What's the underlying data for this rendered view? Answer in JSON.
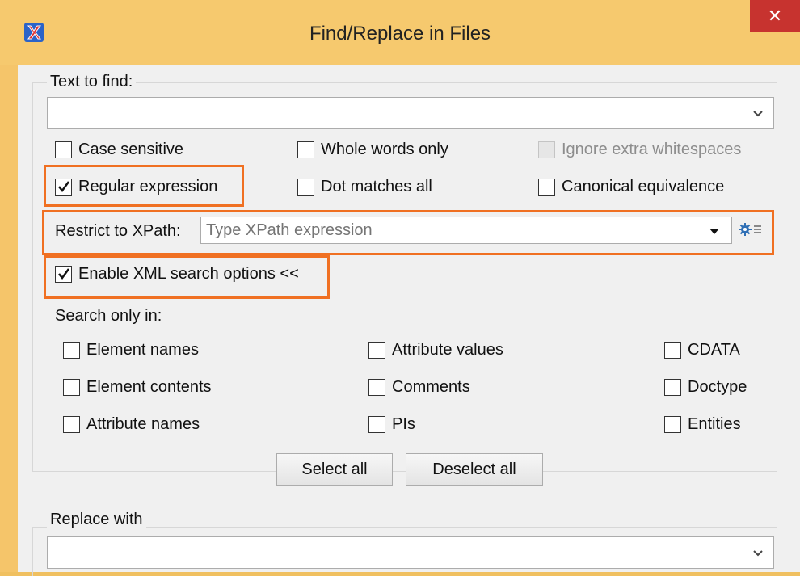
{
  "window": {
    "title": "Find/Replace in Files",
    "close_glyph": "✕",
    "app_icon": "oxygen-x-icon"
  },
  "find": {
    "legend": "Text to find:",
    "value": ""
  },
  "options": {
    "case_sensitive": {
      "label": "Case sensitive",
      "checked": false
    },
    "whole_words": {
      "label": "Whole words only",
      "checked": false
    },
    "ignore_whitespace": {
      "label": "Ignore extra whitespaces",
      "checked": false,
      "disabled": true
    },
    "regex": {
      "label": "Regular expression",
      "checked": true
    },
    "dot_all": {
      "label": "Dot matches all",
      "checked": false
    },
    "canonical": {
      "label": "Canonical equivalence",
      "checked": false
    }
  },
  "xpath": {
    "label": "Restrict to XPath:",
    "placeholder": "Type XPath expression",
    "settings_icon": "gear-menu-icon"
  },
  "xml_options": {
    "label": "Enable XML search options <<",
    "checked": true
  },
  "search_only": {
    "label": "Search only in:",
    "items": [
      {
        "label": "Element names",
        "checked": false
      },
      {
        "label": "Attribute values",
        "checked": false
      },
      {
        "label": "CDATA",
        "checked": false
      },
      {
        "label": "Element contents",
        "checked": false
      },
      {
        "label": "Comments",
        "checked": false
      },
      {
        "label": "Doctype",
        "checked": false
      },
      {
        "label": "Attribute names",
        "checked": false
      },
      {
        "label": "PIs",
        "checked": false
      },
      {
        "label": "Entities",
        "checked": false
      }
    ],
    "select_all": "Select all",
    "deselect_all": "Deselect all"
  },
  "replace": {
    "legend": "Replace with",
    "value": ""
  },
  "colors": {
    "highlight": "#f07022",
    "window_frame": "#f5c56a",
    "close": "#c7332f"
  }
}
